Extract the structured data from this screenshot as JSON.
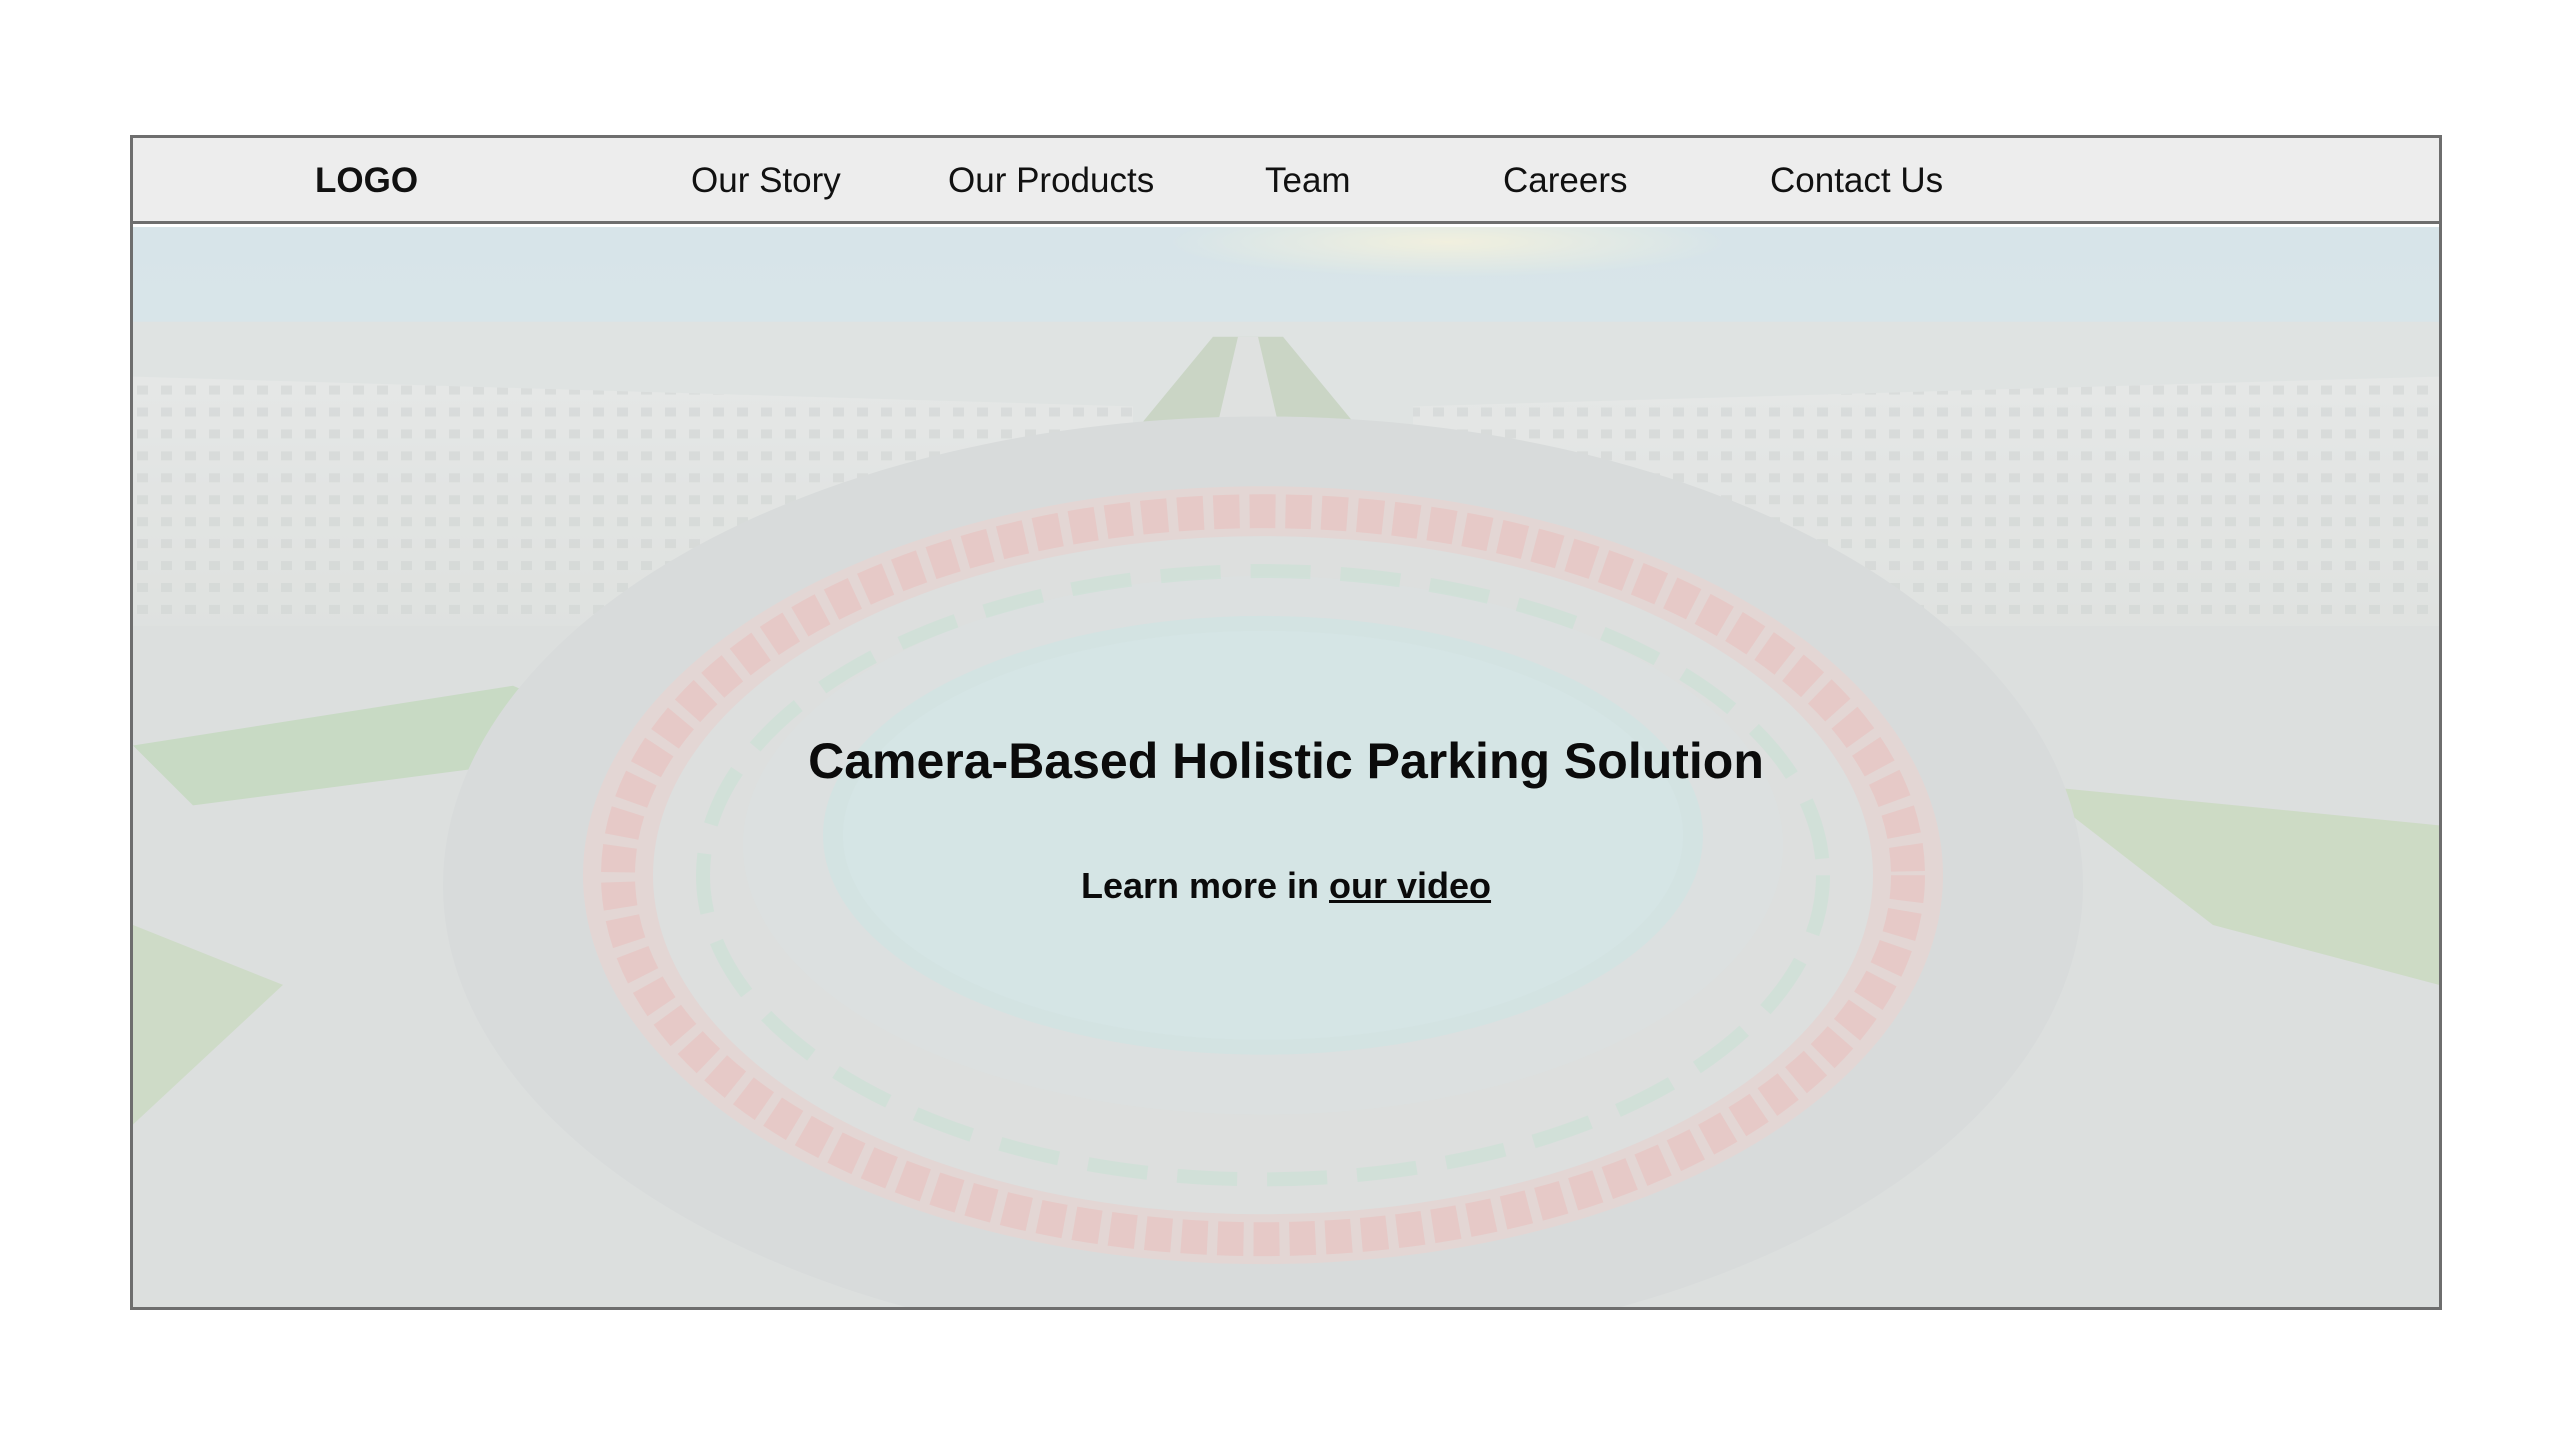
{
  "navbar": {
    "logo": "LOGO",
    "items": [
      {
        "label": "Our Story"
      },
      {
        "label": "Our Products"
      },
      {
        "label": "Team"
      },
      {
        "label": "Careers"
      },
      {
        "label": "Contact Us"
      }
    ]
  },
  "hero": {
    "title": "Camera-Based Holistic Parking Solution",
    "subtitle_prefix": "Learn more in ",
    "subtitle_link": "our video",
    "background_icon": "aerial-city-roundabout-image"
  },
  "colors": {
    "nav_background": "#ededed",
    "border": "#6e6e6e",
    "text": "#0b0b0b"
  }
}
